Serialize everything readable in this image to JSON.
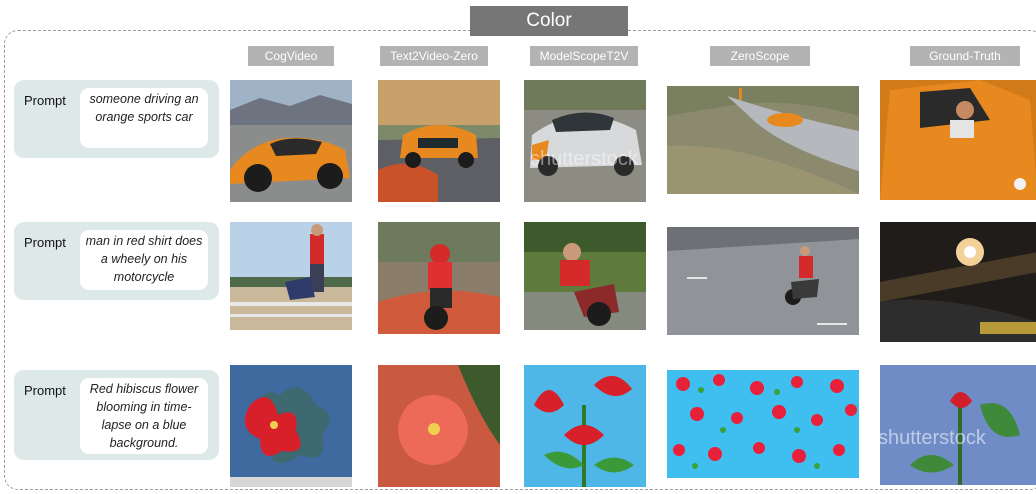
{
  "section_title": "Color",
  "columns": [
    "CogVideo",
    "Text2Video-Zero",
    "ModelScopeT2V",
    "ZeroScope",
    "Ground-Truth"
  ],
  "rows": [
    {
      "label": "Prompt",
      "prompt": "someone driving an orange sports car"
    },
    {
      "label": "Prompt",
      "prompt": "man in red shirt does a wheely on his motorcycle"
    },
    {
      "label": "Prompt",
      "prompt": "Red hibiscus flower blooming in time-lapse  on a blue background."
    }
  ],
  "watermarks": {
    "modelscope_car": "shutterstock",
    "groundtruth_flower": "shutterstock"
  },
  "colors": {
    "title_tab": "#767676",
    "column_header": "#b3b3b3",
    "prompt_box": "#dde9e8",
    "accent_orange": "#e8891f",
    "accent_red": "#d42a2a"
  }
}
